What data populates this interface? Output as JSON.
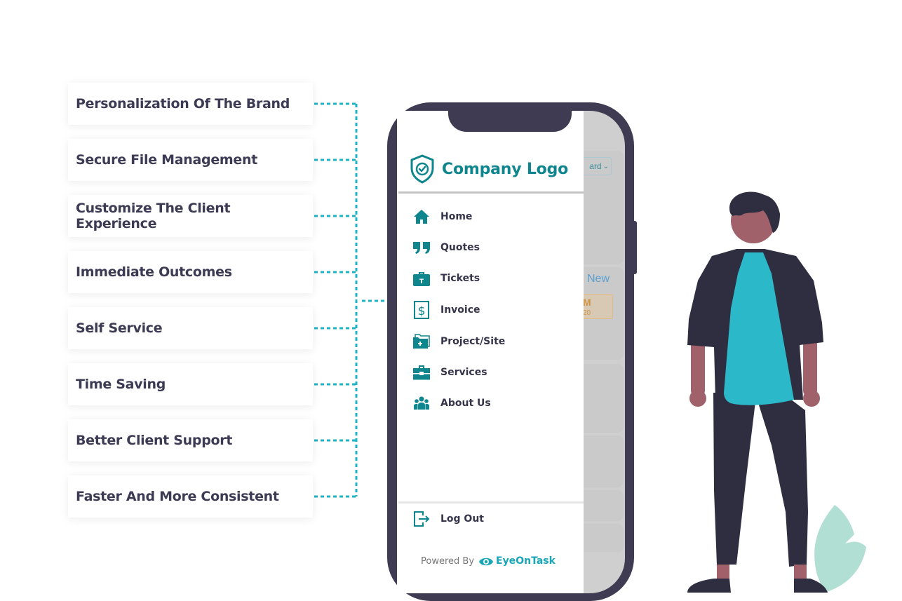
{
  "features": [
    {
      "label": "Personalization Of The Brand"
    },
    {
      "label": "Secure File Management"
    },
    {
      "label": "Customize The Client Experience"
    },
    {
      "label": "Immediate Outcomes"
    },
    {
      "label": "Self Service"
    },
    {
      "label": "Time Saving"
    },
    {
      "label": "Better Client Support"
    },
    {
      "label": "Faster And More Consistent"
    }
  ],
  "colors": {
    "connector": "#1fb3c6",
    "brand": "#0f868d",
    "phone_frame": "#3f3b52",
    "text_dark": "#3d3b54"
  },
  "phone": {
    "drawer": {
      "logo_icon": "shield-check-icon",
      "logo_text": "Company Logo",
      "menu": [
        {
          "label": "Home",
          "icon": "home-icon"
        },
        {
          "label": "Quotes",
          "icon": "quote-icon"
        },
        {
          "label": "Tickets",
          "icon": "ticket-briefcase-icon"
        },
        {
          "label": "Invoice",
          "icon": "dollar-invoice-icon"
        },
        {
          "label": "Project/Site",
          "icon": "folder-plus-icon"
        },
        {
          "label": "Services",
          "icon": "toolbox-icon"
        },
        {
          "label": "About Us",
          "icon": "users-icon"
        }
      ],
      "logout": {
        "label": "Log Out",
        "icon": "logout-icon"
      },
      "powered_by": "Powered By",
      "brand": "EyeOnTask"
    },
    "background_app": {
      "dropdown_fragment": "ard",
      "new_label": "New",
      "badge_line1": "M",
      "badge_line2": "20"
    }
  }
}
